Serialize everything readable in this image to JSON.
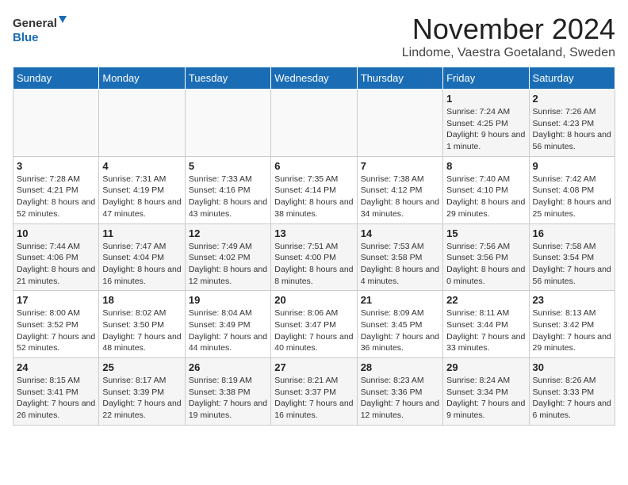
{
  "logo": {
    "line1": "General",
    "line2": "Blue"
  },
  "title": "November 2024",
  "location": "Lindome, Vaestra Goetaland, Sweden",
  "weekdays": [
    "Sunday",
    "Monday",
    "Tuesday",
    "Wednesday",
    "Thursday",
    "Friday",
    "Saturday"
  ],
  "weeks": [
    [
      {
        "day": "",
        "info": ""
      },
      {
        "day": "",
        "info": ""
      },
      {
        "day": "",
        "info": ""
      },
      {
        "day": "",
        "info": ""
      },
      {
        "day": "",
        "info": ""
      },
      {
        "day": "1",
        "info": "Sunrise: 7:24 AM\nSunset: 4:25 PM\nDaylight: 9 hours and 1 minute."
      },
      {
        "day": "2",
        "info": "Sunrise: 7:26 AM\nSunset: 4:23 PM\nDaylight: 8 hours and 56 minutes."
      }
    ],
    [
      {
        "day": "3",
        "info": "Sunrise: 7:28 AM\nSunset: 4:21 PM\nDaylight: 8 hours and 52 minutes."
      },
      {
        "day": "4",
        "info": "Sunrise: 7:31 AM\nSunset: 4:19 PM\nDaylight: 8 hours and 47 minutes."
      },
      {
        "day": "5",
        "info": "Sunrise: 7:33 AM\nSunset: 4:16 PM\nDaylight: 8 hours and 43 minutes."
      },
      {
        "day": "6",
        "info": "Sunrise: 7:35 AM\nSunset: 4:14 PM\nDaylight: 8 hours and 38 minutes."
      },
      {
        "day": "7",
        "info": "Sunrise: 7:38 AM\nSunset: 4:12 PM\nDaylight: 8 hours and 34 minutes."
      },
      {
        "day": "8",
        "info": "Sunrise: 7:40 AM\nSunset: 4:10 PM\nDaylight: 8 hours and 29 minutes."
      },
      {
        "day": "9",
        "info": "Sunrise: 7:42 AM\nSunset: 4:08 PM\nDaylight: 8 hours and 25 minutes."
      }
    ],
    [
      {
        "day": "10",
        "info": "Sunrise: 7:44 AM\nSunset: 4:06 PM\nDaylight: 8 hours and 21 minutes."
      },
      {
        "day": "11",
        "info": "Sunrise: 7:47 AM\nSunset: 4:04 PM\nDaylight: 8 hours and 16 minutes."
      },
      {
        "day": "12",
        "info": "Sunrise: 7:49 AM\nSunset: 4:02 PM\nDaylight: 8 hours and 12 minutes."
      },
      {
        "day": "13",
        "info": "Sunrise: 7:51 AM\nSunset: 4:00 PM\nDaylight: 8 hours and 8 minutes."
      },
      {
        "day": "14",
        "info": "Sunrise: 7:53 AM\nSunset: 3:58 PM\nDaylight: 8 hours and 4 minutes."
      },
      {
        "day": "15",
        "info": "Sunrise: 7:56 AM\nSunset: 3:56 PM\nDaylight: 8 hours and 0 minutes."
      },
      {
        "day": "16",
        "info": "Sunrise: 7:58 AM\nSunset: 3:54 PM\nDaylight: 7 hours and 56 minutes."
      }
    ],
    [
      {
        "day": "17",
        "info": "Sunrise: 8:00 AM\nSunset: 3:52 PM\nDaylight: 7 hours and 52 minutes."
      },
      {
        "day": "18",
        "info": "Sunrise: 8:02 AM\nSunset: 3:50 PM\nDaylight: 7 hours and 48 minutes."
      },
      {
        "day": "19",
        "info": "Sunrise: 8:04 AM\nSunset: 3:49 PM\nDaylight: 7 hours and 44 minutes."
      },
      {
        "day": "20",
        "info": "Sunrise: 8:06 AM\nSunset: 3:47 PM\nDaylight: 7 hours and 40 minutes."
      },
      {
        "day": "21",
        "info": "Sunrise: 8:09 AM\nSunset: 3:45 PM\nDaylight: 7 hours and 36 minutes."
      },
      {
        "day": "22",
        "info": "Sunrise: 8:11 AM\nSunset: 3:44 PM\nDaylight: 7 hours and 33 minutes."
      },
      {
        "day": "23",
        "info": "Sunrise: 8:13 AM\nSunset: 3:42 PM\nDaylight: 7 hours and 29 minutes."
      }
    ],
    [
      {
        "day": "24",
        "info": "Sunrise: 8:15 AM\nSunset: 3:41 PM\nDaylight: 7 hours and 26 minutes."
      },
      {
        "day": "25",
        "info": "Sunrise: 8:17 AM\nSunset: 3:39 PM\nDaylight: 7 hours and 22 minutes."
      },
      {
        "day": "26",
        "info": "Sunrise: 8:19 AM\nSunset: 3:38 PM\nDaylight: 7 hours and 19 minutes."
      },
      {
        "day": "27",
        "info": "Sunrise: 8:21 AM\nSunset: 3:37 PM\nDaylight: 7 hours and 16 minutes."
      },
      {
        "day": "28",
        "info": "Sunrise: 8:23 AM\nSunset: 3:36 PM\nDaylight: 7 hours and 12 minutes."
      },
      {
        "day": "29",
        "info": "Sunrise: 8:24 AM\nSunset: 3:34 PM\nDaylight: 7 hours and 9 minutes."
      },
      {
        "day": "30",
        "info": "Sunrise: 8:26 AM\nSunset: 3:33 PM\nDaylight: 7 hours and 6 minutes."
      }
    ]
  ]
}
